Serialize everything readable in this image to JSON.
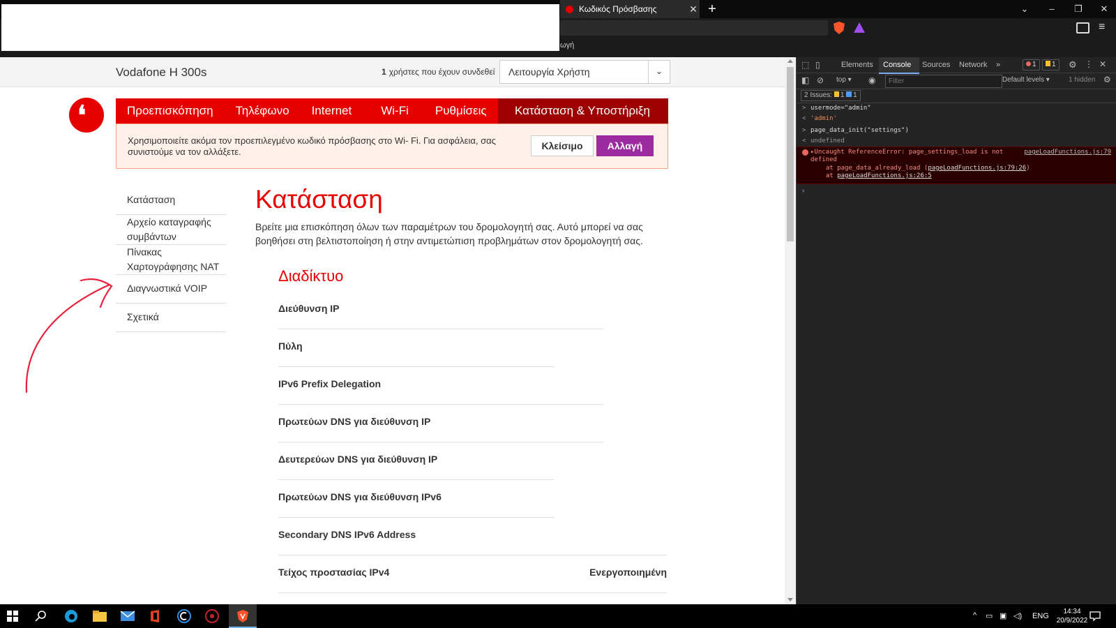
{
  "browser": {
    "tab_title": "Κωδικός Πρόσβασης",
    "tab_close": "✕",
    "new_tab": "+",
    "window_buttons": [
      "⌄",
      "–",
      "❐",
      "✕"
    ],
    "bookmark_fragment": "ωγή",
    "menu_glyph": "≡"
  },
  "router": {
    "brand": "Vodafone H 300s",
    "users_count": "1",
    "users_label": "χρήστες που έχουν συνδεθεί",
    "mode_select": "Λειτουργία Χρήστη",
    "nav": [
      "Προεπισκόπηση",
      "Τηλέφωνο",
      "Internet",
      "Wi-Fi",
      "Ρυθμίσεις",
      "Κατάσταση & Υποστήριξη"
    ],
    "banner": {
      "text": "Χρησιμοποιείτε ακόμα τον προεπιλεγμένο κωδικό πρόσβασης στο Wi- Fi. Για ασφάλεια, σας συνιστούμε να τον αλλάξετε.",
      "close_label": "Κλείσιμο",
      "change_label": "Αλλαγή"
    },
    "side_menu": [
      "Κατάσταση",
      "Αρχείο καταγραφής συμβάντων",
      "Πίνακας Χαρτογράφησης NAT",
      "Διαγνωστικά VOIP",
      "Σχετικά"
    ],
    "page_title": "Κατάσταση",
    "page_desc": "Βρείτε μια επισκόπηση όλων των παραμέτρων του δρομολογητή σας. Αυτό μπορεί να σας βοηθήσει στη βελτιστοποίηση ή στην αντιμετώπιση προβλημάτων στον δρομολογητή σας.",
    "section_title": "Διαδίκτυο",
    "rows": [
      {
        "label": "Διεύθυνση IP",
        "value": ""
      },
      {
        "label": "Πύλη",
        "value": ""
      },
      {
        "label": "IPv6 Prefix Delegation",
        "value": ""
      },
      {
        "label": "Πρωτεύων DNS για διεύθυνση IP",
        "value": ""
      },
      {
        "label": "Δευτερεύων DNS για διεύθυνση IP",
        "value": ""
      },
      {
        "label": "Πρωτεύων DNS για διεύθυνση IPv6",
        "value": ""
      },
      {
        "label": "Secondary DNS IPv6 Address",
        "value": ""
      },
      {
        "label": "Τείχος προστασίας IPv4",
        "value": "Ενεργοποιημένη"
      }
    ]
  },
  "devtools": {
    "tabs": [
      "Elements",
      "Console",
      "Sources",
      "Network",
      "»"
    ],
    "error_count": "1",
    "warn_count": "1",
    "context": "top ▾",
    "filter_placeholder": "Filter",
    "levels": "Default levels ▾",
    "hidden": "1 hidden",
    "issues_label": "2 Issues:",
    "issues_warn": "1",
    "issues_info": "1",
    "console": [
      {
        "prefix": ">",
        "text": "usermode=\"admin\""
      },
      {
        "prefix": "<",
        "text": "'admin'"
      },
      {
        "prefix": ">",
        "text": "page_data_init(\"settings\")"
      },
      {
        "prefix": "<",
        "text": "undefined"
      }
    ],
    "error": {
      "line1": "▸Uncaught ReferenceError: page_settings_load is not",
      "line2": "defined",
      "line3_prefix": "at page_data_already_load (",
      "line3_link": "pageLoadFunctions.js:79:26",
      "line3_suffix": ")",
      "line4_prefix": "at ",
      "line4_link": "pageLoadFunctions.js:26:5",
      "source": "pageLoadFunctions.js:79"
    },
    "prompt": "›"
  },
  "taskbar": {
    "language": "ENG",
    "time": "14:34",
    "date": "20/9/2022"
  },
  "colors": {
    "vodafone_red": "#e60000",
    "nav_active": "#9c0000",
    "change_button": "#9c2aa0",
    "annotation_arrow": "#e8203a"
  }
}
